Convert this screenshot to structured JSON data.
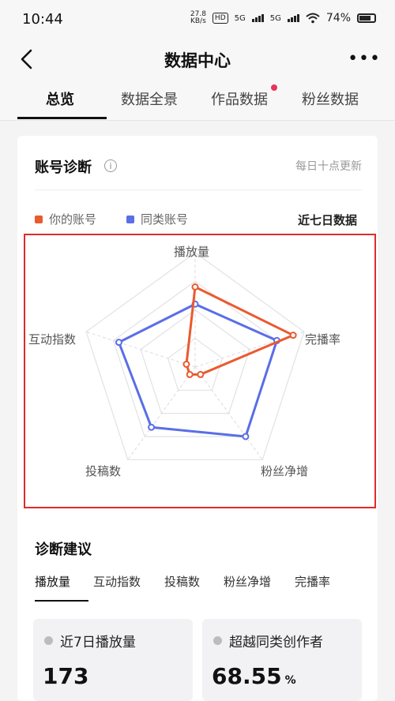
{
  "status": {
    "time": "10:44",
    "speed_top": "27.8",
    "speed_unit": "KB/s",
    "hd": "HD",
    "net1": "5G",
    "net2": "5G",
    "battery": "74%"
  },
  "nav": {
    "title": "数据中心",
    "back_icon": "chevron-left-icon",
    "more_icon": "more-icon"
  },
  "tabs": [
    {
      "label": "总览",
      "active": true
    },
    {
      "label": "数据全景",
      "active": false
    },
    {
      "label": "作品数据",
      "active": false,
      "badge": true
    },
    {
      "label": "粉丝数据",
      "active": false
    }
  ],
  "diagnosis": {
    "title": "账号诊断",
    "update_note": "每日十点更新",
    "legend": [
      {
        "name": "你的账号",
        "color": "#ea5a2f"
      },
      {
        "name": "同类账号",
        "color": "#5a6ee6"
      }
    ],
    "range": "近七日数据"
  },
  "chart_data": {
    "type": "radar",
    "axes": [
      "播放量",
      "完播率",
      "粉丝净增",
      "投稿数",
      "互动指数"
    ],
    "range": [
      0,
      100
    ],
    "series": [
      {
        "name": "你的账号",
        "color": "#ea5a2f",
        "values": [
          70,
          90,
          8,
          8,
          8
        ]
      },
      {
        "name": "同类账号",
        "color": "#5a6ee6",
        "values": [
          55,
          75,
          75,
          65,
          70
        ]
      }
    ]
  },
  "advice": {
    "title": "诊断建议",
    "tabs": [
      "播放量",
      "互动指数",
      "投稿数",
      "粉丝净增",
      "完播率"
    ],
    "stats": [
      {
        "label": "近7日播放量",
        "value": "173",
        "unit": ""
      },
      {
        "label": "超越同类创作者",
        "value": "68.55",
        "unit": "%"
      }
    ]
  }
}
